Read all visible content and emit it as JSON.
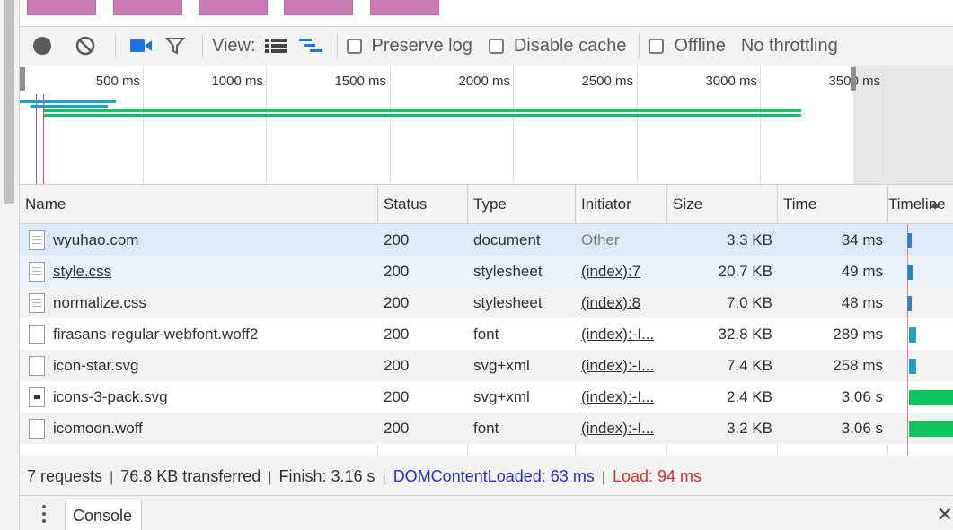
{
  "toolbar": {
    "view_label": "View:",
    "preserve_log": "Preserve log",
    "disable_cache": "Disable cache",
    "offline": "Offline",
    "throttling": "No throttling"
  },
  "overview": {
    "ticks": [
      "500 ms",
      "1000 ms",
      "1500 ms",
      "2000 ms",
      "2500 ms",
      "3000 ms",
      "3500 ms"
    ]
  },
  "columns": {
    "name": "Name",
    "status": "Status",
    "type": "Type",
    "initiator": "Initiator",
    "size": "Size",
    "time": "Time",
    "timeline": "Timeline"
  },
  "requests": [
    {
      "name": "wyuhao.com",
      "status": "200",
      "type": "document",
      "initiator": "Other",
      "size": "3.3 KB",
      "time": "34 ms",
      "bar_color": "#1a8ad3"
    },
    {
      "name": "style.css",
      "status": "200",
      "type": "stylesheet",
      "initiator": "(index):7",
      "size": "20.7 KB",
      "time": "49 ms",
      "bar_color": "#1a8ad3"
    },
    {
      "name": "normalize.css",
      "status": "200",
      "type": "stylesheet",
      "initiator": "(index):8",
      "size": "7.0 KB",
      "time": "48 ms",
      "bar_color": "#1a8ad3"
    },
    {
      "name": "firasans-regular-webfont.woff2",
      "status": "200",
      "type": "font",
      "initiator": "(index):-I...",
      "size": "32.8 KB",
      "time": "289 ms",
      "bar_color": "#1aa3c7"
    },
    {
      "name": "icon-star.svg",
      "status": "200",
      "type": "svg+xml",
      "initiator": "(index):-I...",
      "size": "7.4 KB",
      "time": "258 ms",
      "bar_color": "#1aa3c7"
    },
    {
      "name": "icons-3-pack.svg",
      "status": "200",
      "type": "svg+xml",
      "initiator": "(index):-I...",
      "size": "2.4 KB",
      "time": "3.06 s",
      "bar_color": "#0fc35d"
    },
    {
      "name": "icomoon.woff",
      "status": "200",
      "type": "font",
      "initiator": "(index):-I...",
      "size": "3.2 KB",
      "time": "3.06 s",
      "bar_color": "#0fc35d"
    }
  ],
  "summary": {
    "requests": "7 requests",
    "transferred": "76.8 KB transferred",
    "finish": "Finish: 3.16 s",
    "dcl": "DOMContentLoaded: 63 ms",
    "load": "Load: 94 ms",
    "dcl_color": "#2a2ad2",
    "load_color": "#d42b2b"
  },
  "drawer": {
    "console_tab": "Console"
  }
}
